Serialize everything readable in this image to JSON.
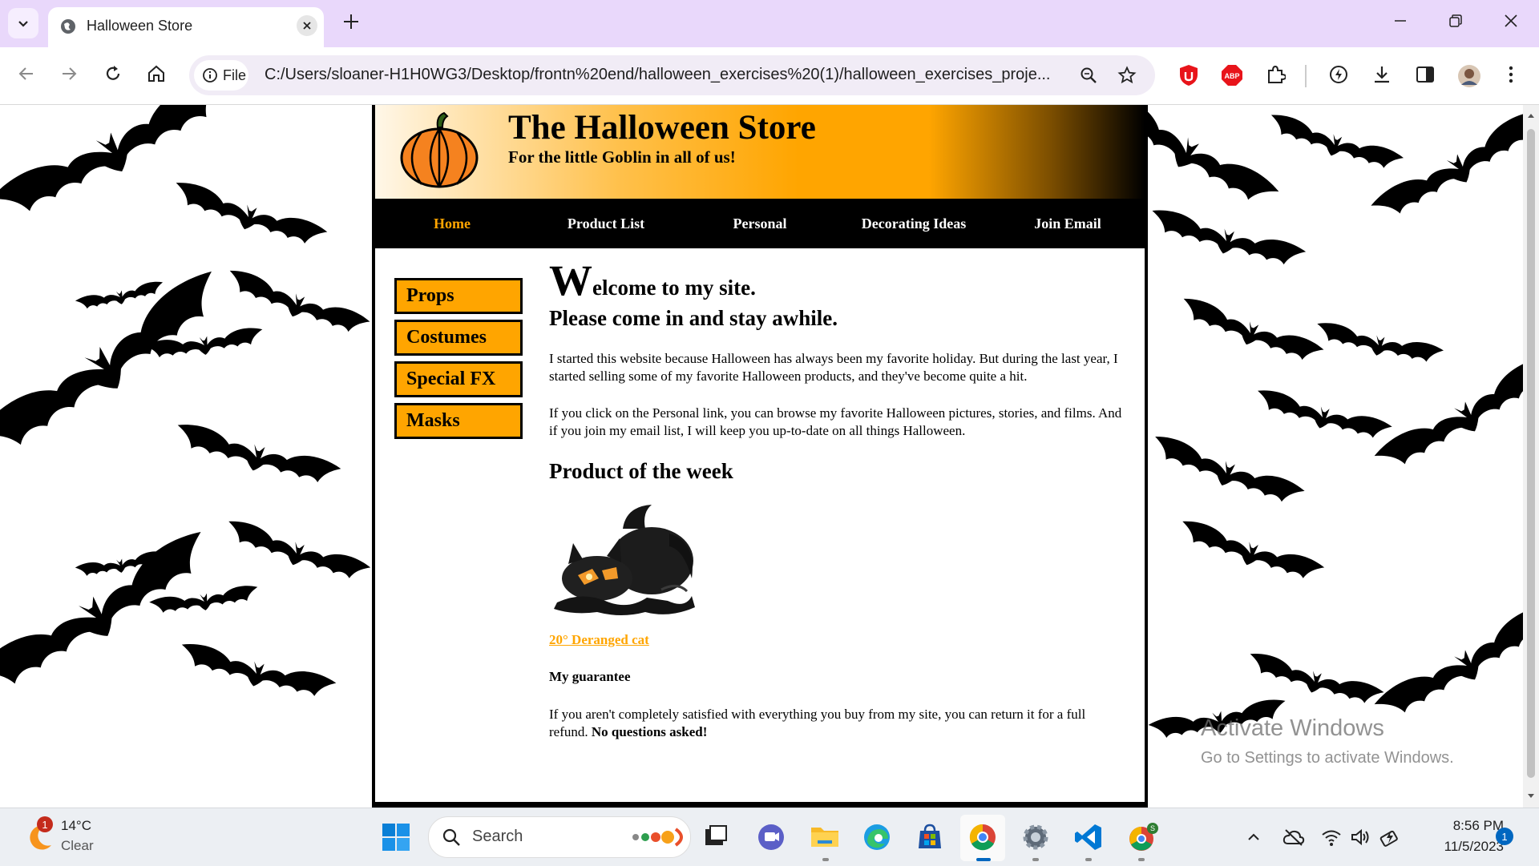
{
  "browser": {
    "tab_title": "Halloween Store",
    "chip_label": "File",
    "url": "C:/Users/sloaner-H1H0WG3/Desktop/frontn%20end/halloween_exercises%20(1)/halloween_exercises_proje..."
  },
  "site": {
    "title": "The Halloween Store",
    "tagline": "For the little Goblin in all of us!",
    "nav": [
      {
        "label": "Home",
        "active": true
      },
      {
        "label": "Product List"
      },
      {
        "label": "Personal"
      },
      {
        "label": "Decorating Ideas"
      },
      {
        "label": "Join Email"
      }
    ],
    "sidebar": [
      "Props",
      "Costumes",
      "Special FX",
      "Masks"
    ],
    "welcome_initial": "W",
    "welcome_rest": "elcome to my site.",
    "subheading": "Please come in and stay awhile.",
    "paragraph1": "I started this website because Halloween has always been my favorite holiday. But during the last year, I started selling some of my favorite Halloween products, and they've become quite a hit.",
    "paragraph2": "If you click on the Personal link, you can browse my favorite Halloween pictures, stories, and films. And if you join my email list, I will keep you up-to-date on all things Halloween.",
    "product_heading": "Product of the week",
    "product_link": "20° Deranged cat",
    "guarantee_heading": "My guarantee",
    "guarantee_text": "If you aren't completely satisfied with everything you buy from my site, you can return it for a full refund.",
    "guarantee_emphasis": "No questions asked!"
  },
  "watermark": {
    "line1": "Activate Windows",
    "line2": "Go to Settings to activate Windows."
  },
  "taskbar": {
    "weather_badge": "1",
    "temperature": "14°C",
    "condition": "Clear",
    "search_placeholder": "Search",
    "time": "8:56 PM",
    "date": "11/5/2023",
    "notification_count": "1"
  },
  "colors": {
    "accent": "#ffa500",
    "nav_bg": "#000000",
    "tabbar": "#e9d8fb"
  }
}
